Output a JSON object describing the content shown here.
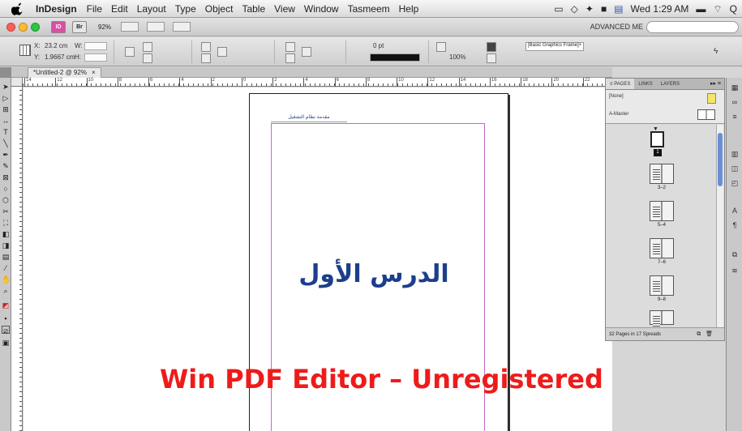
{
  "menubar": {
    "app_name": "InDesign",
    "items": [
      "File",
      "Edit",
      "Layout",
      "Type",
      "Object",
      "Table",
      "View",
      "Window",
      "Tasmeem",
      "Help"
    ],
    "clock": "Wed 1:29 AM"
  },
  "appbar": {
    "badges": [
      "ID",
      "Br"
    ],
    "zoom": "92%",
    "workspace": "ADVANCED ME",
    "search_placeholder": "",
    "traffic_colors": [
      "#ff5f57",
      "#ffbd2e",
      "#28c940"
    ]
  },
  "control": {
    "x_label": "X:",
    "x_value": "23.2 cm",
    "y_label": "Y:",
    "y_value": "1.9667 cm",
    "w_label": "W:",
    "h_label": "H:",
    "stroke_weight": "0 pt",
    "opacity": "100%",
    "frame_style": "[Basic Graphics Frame]+"
  },
  "document": {
    "tab_title": "*Untitled-2 @ 92%",
    "tab_close": "×",
    "ruler_ticks": [
      "14",
      "12",
      "10",
      "8",
      "6",
      "4",
      "2",
      "0",
      "2",
      "4",
      "6",
      "8",
      "10",
      "12",
      "14",
      "16",
      "18",
      "20",
      "22"
    ],
    "header_text": "مقدمة نظام التشغيل",
    "lesson_title": "الدرس الأول",
    "accent_color": "#1c3f8c"
  },
  "watermark": {
    "text": "Win PDF Editor – Unregistered",
    "color": "#ee1b1b"
  },
  "pages_panel": {
    "tabs": [
      "PAGES",
      "LINKS",
      "LAYERS"
    ],
    "tab_prefix": "≡",
    "menu_glyph": "▸▸ ≡",
    "master_none": "[None]",
    "master_a": "A-Master",
    "first_page_number": "1",
    "spread_labels": [
      "3–2",
      "5–4",
      "7–6",
      "9–8"
    ],
    "status": "32 Pages in 17 Spreads"
  },
  "icons": {
    "apple": "apple-icon",
    "search": "search-icon",
    "wifi": "wifi-icon",
    "volume": "volume-icon",
    "battery": "battery-icon"
  }
}
